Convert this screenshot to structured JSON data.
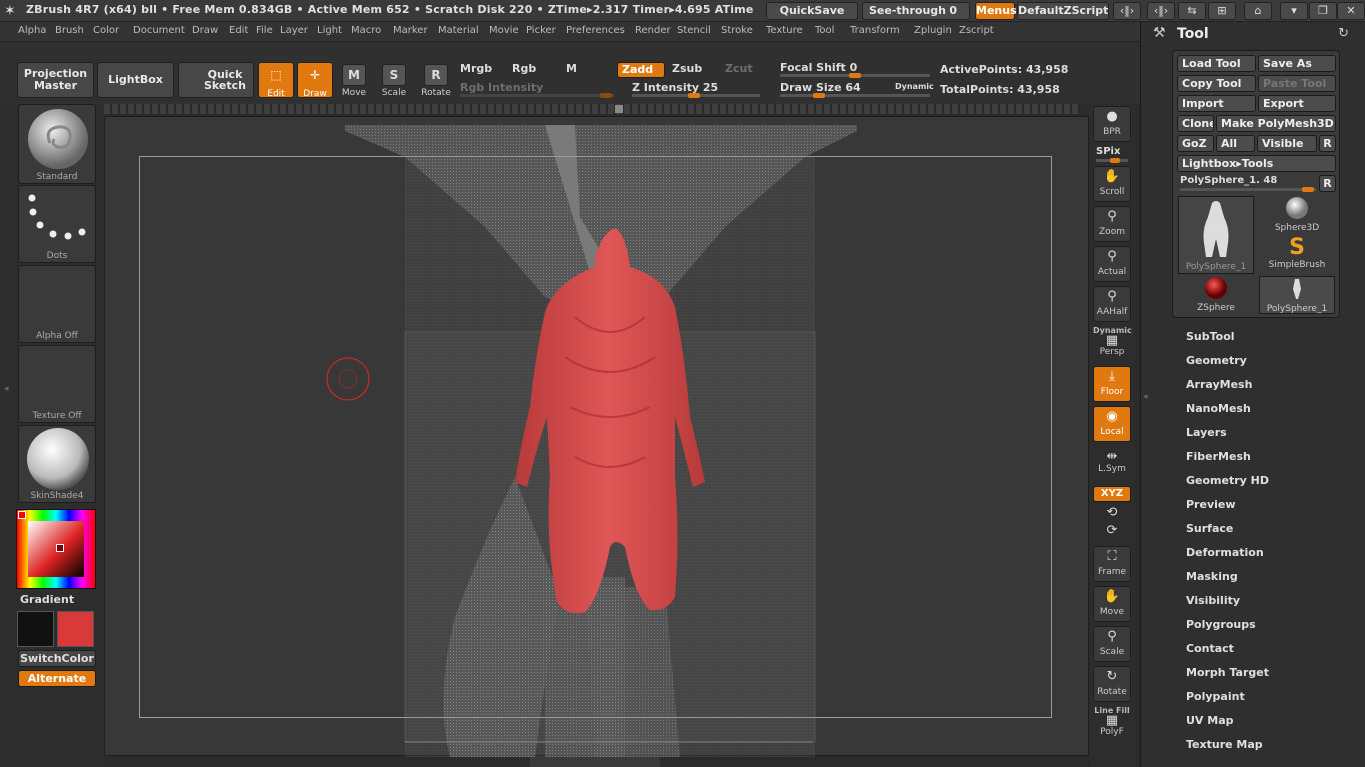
{
  "titlebar": {
    "text": "ZBrush 4R7 (x64)    bll    • Free Mem 0.834GB • Active Mem 652 • Scratch Disk 220 • ZTime▸2.317  Timer▸4.695  ATime",
    "quicksave": "QuickSave",
    "seethrough": "See-through",
    "seethrough_value": "0",
    "menus": "Menus",
    "defaultzscript": "DefaultZScript"
  },
  "menubar": [
    "Alpha",
    "Brush",
    "Color",
    "Document",
    "Draw",
    "Edit",
    "File",
    "Layer",
    "Light",
    "Macro",
    "Marker",
    "Material",
    "Movie",
    "Picker",
    "Preferences",
    "Render",
    "Stencil",
    "Stroke",
    "Texture",
    "Tool",
    "Transform",
    "Zplugin",
    "Zscript"
  ],
  "shelf": {
    "projection_master_1": "Projection",
    "projection_master_2": "Master",
    "lightbox": "LightBox",
    "quick_sketch_1": "Quick",
    "quick_sketch_2": "Sketch",
    "edit": "Edit",
    "draw": "Draw",
    "move": "Move",
    "scale": "Scale",
    "rotate": "Rotate",
    "mrgb": "Mrgb",
    "rgb": "Rgb",
    "m": "M",
    "rgb_intensity": "Rgb  Intensity",
    "zadd": "Zadd",
    "zsub": "Zsub",
    "zcut": "Zcut",
    "z_intensity_label": "Z  Intensity",
    "z_intensity_value": "25",
    "focal_shift_label": "Focal  Shift",
    "focal_shift_value": "0",
    "draw_size_label": "Draw  Size",
    "draw_size_value": "64",
    "dynamic": "Dynamic",
    "active_points": "ActivePoints: 43,958",
    "total_points": "TotalPoints: 43,958"
  },
  "lefttray": {
    "brush": "Standard",
    "stroke": "Dots",
    "alpha": "Alpha  Off",
    "texture": "Texture  Off",
    "material": "SkinShade4",
    "gradient": "Gradient",
    "switchcolor": "SwitchColor",
    "alternate": "Alternate",
    "primary_color": "#111111",
    "secondary_color": "#d83a3a"
  },
  "rtools": {
    "bpr": "BPR",
    "spix": "SPix",
    "scroll": "Scroll",
    "zoom": "Zoom",
    "actual": "Actual",
    "aahalf": "AAHalf",
    "dynamic": "Dynamic",
    "persp": "Persp",
    "floor": "Floor",
    "local": "Local",
    "lsym": "L.Sym",
    "xyz": "XYZ",
    "frame": "Frame",
    "move": "Move",
    "scale": "Scale",
    "rotate": "Rotate",
    "linefill": "Line Fill",
    "polyf": "PolyF"
  },
  "palette": {
    "title": "Tool",
    "load_tool": "Load  Tool",
    "save_as": "Save  As",
    "copy_tool": "Copy  Tool",
    "paste_tool": "Paste  Tool",
    "import": "Import",
    "export": "Export",
    "clone": "Clone",
    "make_polymesh": "Make  PolyMesh3D",
    "goz": "GoZ",
    "all": "All",
    "visible": "Visible",
    "r": "R",
    "lightbox_tools": "Lightbox▸Tools",
    "current_tool": "PolySphere_1. 48",
    "thumbs": [
      "PolySphere_1",
      "Sphere3D",
      "SimpleBrush",
      "ZSphere",
      "PolySphere_1"
    ],
    "subpalettes": [
      "SubTool",
      "Geometry",
      "ArrayMesh",
      "NanoMesh",
      "Layers",
      "FiberMesh",
      "Geometry HD",
      "Preview",
      "Surface",
      "Deformation",
      "Masking",
      "Visibility",
      "Polygroups",
      "Contact",
      "Morph Target",
      "Polypaint",
      "UV Map",
      "Texture Map"
    ]
  }
}
